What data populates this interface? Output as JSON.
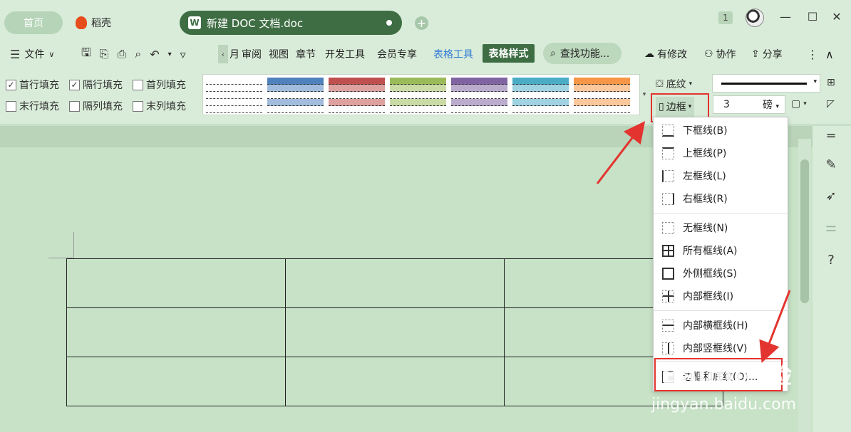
{
  "tabs": {
    "home": "首页",
    "daoke": "稻壳",
    "doc": "新建 DOC 文档.doc",
    "add": "+"
  },
  "window": {
    "badge": "1",
    "minimize": "—",
    "maximize": "☐",
    "close": "✕"
  },
  "menubar": {
    "file": "文件",
    "review_partial": "月",
    "review": "审阅",
    "view": "视图",
    "chapter": "章节",
    "dev_tools": "开发工具",
    "member": "会员专享",
    "table_tools": "表格工具",
    "table_style": "表格样式",
    "search": "查找功能...",
    "changes": "有修改",
    "collab": "协作",
    "share": "分享"
  },
  "ribbon": {
    "checks": [
      {
        "label": "首行填充",
        "checked": true
      },
      {
        "label": "隔行填充",
        "checked": true
      },
      {
        "label": "首列填充",
        "checked": false
      },
      {
        "label": "末行填充",
        "checked": false
      },
      {
        "label": "隔列填充",
        "checked": false
      },
      {
        "label": "末列填充",
        "checked": false
      }
    ],
    "swatch_colors": [
      "#ffffff",
      "#4f81bd",
      "#c0504d",
      "#9bbb59",
      "#8064a2",
      "#4bacc6",
      "#f79646"
    ],
    "shading": "底纹",
    "border": "边框",
    "line_size": "3",
    "line_unit": "磅"
  },
  "dropdown": {
    "items": [
      "下框线(B)",
      "上框线(P)",
      "左框线(L)",
      "右框线(R)",
      "无框线(N)",
      "所有框线(A)",
      "外侧框线(S)",
      "内部框线(I)",
      "内部横框线(H)",
      "内部竖框线(V)",
      "边框和底纹(O)..."
    ]
  },
  "watermark": {
    "brand": "Baidu经验",
    "url": "jingyan.baidu.com"
  },
  "colors": {
    "accent_green": "#3e6d43",
    "highlight_red": "#e3342f",
    "link_blue": "#2f7ad6"
  }
}
